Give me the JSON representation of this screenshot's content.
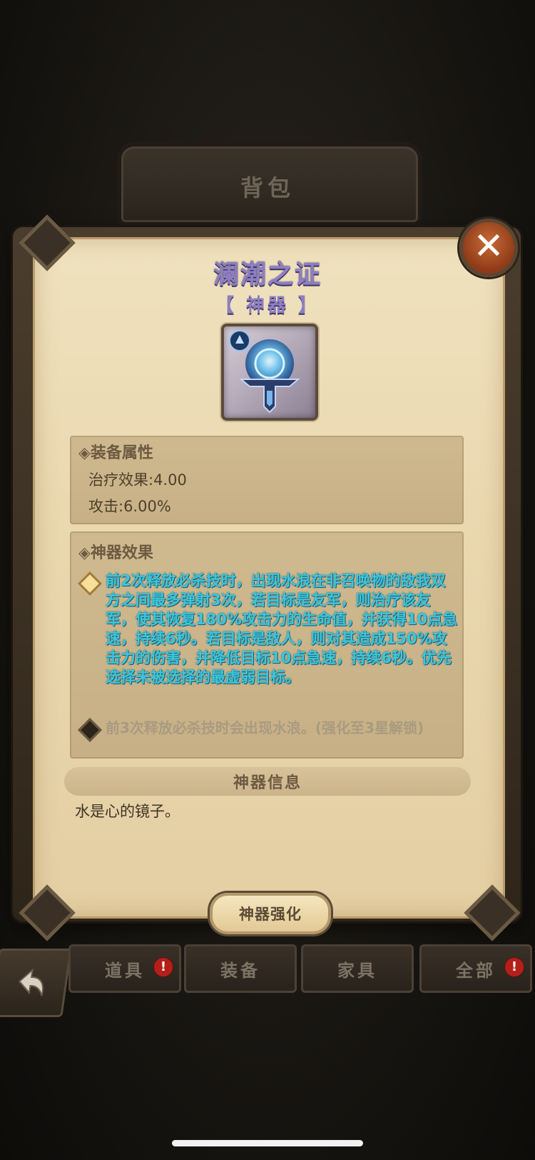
{
  "header": {
    "bag_title": "背包"
  },
  "tabs": [
    {
      "label": "道具",
      "alert": "!"
    },
    {
      "label": "装备",
      "alert": ""
    },
    {
      "label": "家具",
      "alert": ""
    },
    {
      "label": "全部",
      "alert": "!"
    }
  ],
  "dialog": {
    "title": "澜潮之证",
    "subtitle": "【 神器 】",
    "close_icon": "close-icon",
    "attributes": {
      "heading": "◈装备属性",
      "items": [
        "治疗效果:4.00",
        "攻击:6.00%"
      ]
    },
    "effects": {
      "heading": "◈神器效果",
      "active": "前2次释放必杀技时，出现水浪在非召唤物的敌我双方之间最多弹射3次，若目标是友军，则治疗该友军，使其恢复180%攻击力的生命值，并获得10点急速，持续6秒。若目标是敌人，则对其造成150%攻击力的伤害，并降低目标10点急速，持续6秒。优先选择未被选择的最虚弱目标。",
      "locked": "前3次释放必杀技时会出现水浪。(强化至3星解锁)"
    },
    "info": {
      "heading": "神器信息",
      "description": "水是心的镜子。"
    },
    "upgrade_label": "神器强化"
  },
  "colors": {
    "title": "#8d7fc2",
    "effect_text": "#3ec6d8",
    "alert": "#b3201a"
  }
}
